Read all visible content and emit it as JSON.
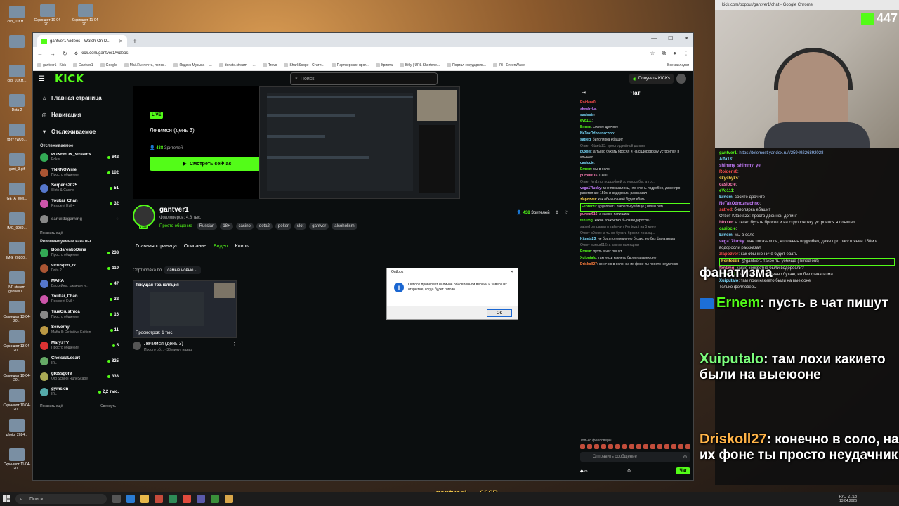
{
  "desktop": {
    "left_icons": [
      "clip_01KH...",
      "",
      "clip_01KH...",
      "Dota 2",
      "fg-f7YwUb...",
      "gant_3.gif",
      "GETA_Wel...",
      "IMG_9939...",
      "IMG_20200...",
      "NP stream gantver1...",
      "Скриншот 13-04-20...",
      "Скриншот 13-04-20...",
      "Скриншот 10-04-20...",
      "Скриншот 10-04-20...",
      "photo_2024...",
      "Скриншот 11-04-20..."
    ],
    "top_icons": [
      "Скриншот 10-04-20...",
      "Скриншот 11-04-20..."
    ]
  },
  "browser": {
    "tab_title": "gantver1 Videos - Watch On-D...",
    "url": "kick.com/gantver1/videos",
    "bookmarks": [
      "gantver1 | Kick",
      "Gantver1",
      "Google",
      "Mail.Ru: почта, поиск...",
      "Яндекс Музыка —...",
      "donate.stream — ...",
      "Trovo",
      "SharkScope - Стати...",
      "Партнерские прог...",
      "Крипта",
      "Bitly | URL Shortene...",
      "Портал государств...",
      "7B - GreenWave"
    ],
    "all_bookmarks": "Все закладки"
  },
  "kick": {
    "logo": "KICK",
    "search_placeholder": "Поиск",
    "get_kicks": "Получить KICKs",
    "nav": [
      {
        "label": "Главная страница",
        "icon": "home-icon"
      },
      {
        "label": "Навигация",
        "icon": "compass-icon"
      },
      {
        "label": "Отслеживаемое",
        "icon": "heart-icon"
      }
    ],
    "followed_title": "Отслеживаемое",
    "followed": [
      {
        "name": "POKEROK_streams",
        "sub": "Poker",
        "viewers": "642"
      },
      {
        "name": "YNKNOWme",
        "sub": "Просто общение",
        "viewers": "102"
      },
      {
        "name": "Serpens2025",
        "sub": "Slots & Casino",
        "viewers": "51"
      },
      {
        "name": "Youkai_Chan",
        "sub": "Resident Evil 4",
        "viewers": "32"
      },
      {
        "name": "sanuidagaming",
        "sub": "",
        "viewers": ""
      }
    ],
    "show_more": "Показать ещё",
    "recommended_title": "Рекомендуемые каналы",
    "recommended": [
      {
        "name": "BondarenkoDima",
        "sub": "Просто общение",
        "viewers": "238"
      },
      {
        "name": "virtuspro_tv",
        "sub": "Dota 2",
        "viewers": "119"
      },
      {
        "name": "MARA",
        "sub": "Бассейны, джакузи и...",
        "viewers": "47"
      },
      {
        "name": "Youkai_Chan",
        "sub": "Resident Evil 4",
        "viewers": "32"
      },
      {
        "name": "TrueGrustnica",
        "sub": "Просто общение",
        "viewers": "16"
      },
      {
        "name": "Servernyi",
        "sub": "Mafia II: Definitive Edition",
        "viewers": "11"
      },
      {
        "name": "MarysTV",
        "sub": "Просто общение",
        "viewers": "5"
      },
      {
        "name": "ChelseaLeeart",
        "sub": "IRL",
        "viewers": "825"
      },
      {
        "name": "grossgore",
        "sub": "Old School RuneScape",
        "viewers": "333"
      },
      {
        "name": "gymskin",
        "sub": "IRL",
        "viewers": "2,2 тыс."
      }
    ],
    "collapse": "Свернуть",
    "player": {
      "live": "LIVE",
      "title": "Лечимся (день 3)",
      "viewers_num": "438",
      "viewers_label": "Зрителей",
      "watch_now": "Смотреть сейчас"
    },
    "channel": {
      "name": "gantver1",
      "followers": "Фолловеров: 4,6 тыс.",
      "category": "Просто общение",
      "tags": [
        "Russian",
        "18+",
        "casino",
        "dota2",
        "poker",
        "slot",
        "gantver",
        "alcoholism"
      ],
      "viewers": "438",
      "viewers_label": "Зрителей",
      "live_tag": "LIVE"
    },
    "tabs": [
      "Главная страница",
      "Описание",
      "Видео",
      "Клипы"
    ],
    "active_tab": "Видео",
    "sort_label": "Сортировка по",
    "sort_value": "самые новые",
    "video": {
      "badge": "Текущая трансляция",
      "views": "Просмотров: 1 тыс.",
      "title": "Лечимся (день 3)",
      "category": "Просто об...",
      "time": "36 минут назад"
    },
    "dialog": {
      "title": "Outlook",
      "message": "Outlook проверяет наличие обновленной версии и завершит открытие, когда будет готово.",
      "ok": "ОК"
    },
    "chat": {
      "title": "Чат",
      "messages": [
        {
          "user": "Roidenr0",
          "color": "#ff4d4d",
          "text": ""
        },
        {
          "user": "skyshyks",
          "color": "#c77dff",
          "text": ""
        },
        {
          "user": "casiocie",
          "color": "#7bdcff",
          "text": ""
        },
        {
          "user": "eVo111",
          "color": "#53fc18",
          "text": ""
        },
        {
          "user": "Ernem",
          "color": "#53fc18",
          "text": "сосите дрочите"
        },
        {
          "user": "NeTakOdnoznachno",
          "color": "#7bdcff",
          "text": ""
        },
        {
          "user": "satred",
          "color": "#7bdcff",
          "text": "биполярка ебашит"
        },
        {
          "user": "",
          "color": "#888",
          "text": "Ответ Kitaets23: просто двойной допинг"
        },
        {
          "user": "b0xxer",
          "color": "#7bdcff",
          "text": "а ты во бухать бросил и на сцдоровозку устроился я слышал"
        },
        {
          "user": "casiocie",
          "color": "#7bdcff",
          "text": ""
        },
        {
          "user": "Ernem",
          "color": "#53fc18",
          "text": "мы в соло"
        },
        {
          "user": "purpur616",
          "color": "#ff7eb6",
          "text": "Сыш..."
        },
        {
          "user": "",
          "color": "#888",
          "text": "Ответ fen1mg: подробней хотелось бы, а то..."
        },
        {
          "user": "vega17lucky",
          "color": "#c77dff",
          "text": "мне показалось, что очень подробно, даже про расстояние 150м и водоросли рассказал"
        },
        {
          "user": "zlapozver",
          "color": "#ffd34d",
          "text": "как обычно ничё будет ебать"
        },
        {
          "user": "Fentezzii",
          "color": "#53fc18",
          "text": "@gantver1 такое ты уебище (Timed out)"
        },
        {
          "user": "purpur616",
          "color": "#ff7eb6",
          "text": "а как же папищики"
        },
        {
          "user": "fen1mg",
          "color": "#53fc18",
          "text": "какие конкретно были водоросли?"
        },
        {
          "user": "",
          "color": "#888",
          "text": "satred отправил в тайм-аут Fentezzii на 5 минут"
        },
        {
          "user": "",
          "color": "#888",
          "text": "Ответ b0xxer: а ты во бухать бросил и на сц..."
        },
        {
          "user": "Kitaets23",
          "color": "#7bdcff",
          "text": "не брат,попеременно бухаю, но без фанатизма"
        },
        {
          "user": "",
          "color": "#888",
          "text": "Ответ purpur616: а как же папищики"
        },
        {
          "user": "Ernem",
          "color": "#53fc18",
          "text": "пусть в чат пишут"
        },
        {
          "user": "Xuiputalo",
          "color": "#53fc18",
          "text": "там лохи какието были на выеюоне"
        },
        {
          "user": "Driskoll27",
          "color": "#ff7e3d",
          "text": "конечно в соло, на их фоне ты просто неудачник"
        }
      ],
      "followers_only": "Только фолловеры",
      "input_placeholder": "Отправить сообщение",
      "send": "Чат"
    }
  },
  "overlay": {
    "popout_title": "kick.com/popout/gantver1/chat - Google Chrome",
    "counter": "447",
    "chat_lines": [
      {
        "user": "gantver1",
        "text": "https://telemost.yandex.ru/j/25949226892028",
        "link": true
      },
      {
        "user": "Alfa13",
        "text": ""
      },
      {
        "user": "shimmy_shimmy_ye",
        "text": ""
      },
      {
        "user": "Roidenr0",
        "text": ""
      },
      {
        "user": "skyshyks",
        "text": ""
      },
      {
        "user": "casiocie",
        "text": ""
      },
      {
        "user": "eVo111",
        "text": ""
      },
      {
        "user": "Ernem",
        "text": "сосите дрочите"
      },
      {
        "user": "NeTakOdnoznachno",
        "text": ""
      },
      {
        "user": "satred",
        "text": "биполярка ебашит"
      },
      {
        "user": "",
        "text": "Ответ Kitaets23: просто двойной допинг"
      },
      {
        "user": "b0xxer",
        "text": "а ты во бухать бросил и на сцдоровозку устроился я слышал"
      },
      {
        "user": "casiocie",
        "text": ""
      },
      {
        "user": "Ernem",
        "text": "мы в соло"
      },
      {
        "user": "vega17lucky",
        "text": "мне показалось, что очень подробно, даже про расстояние 150м и водоросли рассказал"
      },
      {
        "user": "zlapozver",
        "text": "как обычно ничё будет ебать"
      },
      {
        "user": "Fentezzii",
        "text": "@gantver1 такое ты уебище (Timed out)"
      },
      {
        "user": "fen1mg",
        "text": "какие конкретно были водоросли?"
      },
      {
        "user": "Kitaets23",
        "text": "не брат,попеременно бухаю, но без фанатизма"
      },
      {
        "user": "Xuiputalo",
        "text": "там лохи какието были на выеюоне"
      },
      {
        "user": "",
        "text": "Только фолловеры"
      }
    ],
    "big_lines": [
      {
        "user": "",
        "text": "фанатизма"
      },
      {
        "user": "Ernem",
        "text": ": пусть в чат пишут"
      },
      {
        "user": "Xuiputalo",
        "text": ": там лохи какието были на выеюоне"
      },
      {
        "user": "Driskoll27",
        "text": ": конечно в соло, на их фоне ты просто неудачник"
      }
    ],
    "ticker": "gantver1 — 666P"
  },
  "taskbar": {
    "search": "Поиск",
    "time": "21:18",
    "date": "13.04.2026",
    "lang": "РУС"
  }
}
